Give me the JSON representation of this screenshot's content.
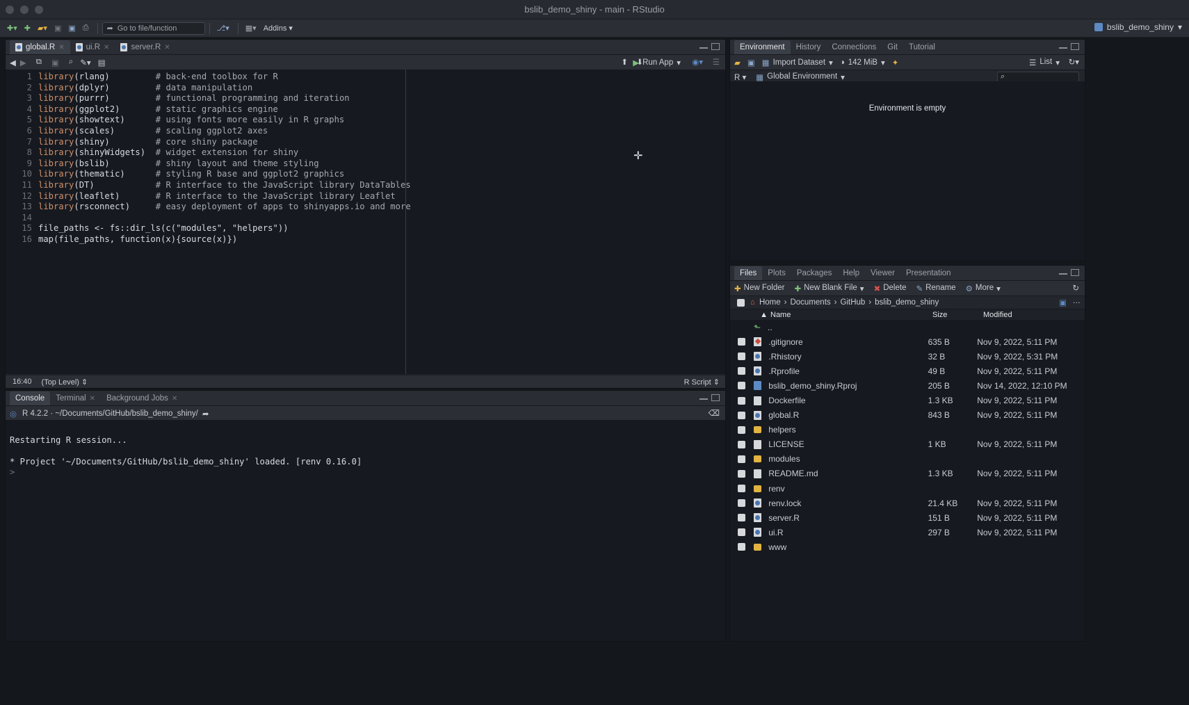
{
  "window": {
    "title": "bslib_demo_shiny - main - RStudio"
  },
  "toolbar": {
    "goto_placeholder": "Go to file/function",
    "addins_label": "Addins",
    "project_label": "bslib_demo_shiny"
  },
  "source": {
    "tabs": [
      {
        "label": "global.R",
        "active": true
      },
      {
        "label": "ui.R",
        "active": false
      },
      {
        "label": "server.R",
        "active": false
      }
    ],
    "run_app_label": "Run App",
    "lines": [
      {
        "n": "1",
        "pkg": "rlang",
        "comment": "# back-end toolbox for R"
      },
      {
        "n": "2",
        "pkg": "dplyr",
        "comment": "# data manipulation"
      },
      {
        "n": "3",
        "pkg": "purrr",
        "comment": "# functional programming and iteration"
      },
      {
        "n": "4",
        "pkg": "ggplot2",
        "comment": "# static graphics engine"
      },
      {
        "n": "5",
        "pkg": "showtext",
        "comment": "# using fonts more easily in R graphs"
      },
      {
        "n": "6",
        "pkg": "scales",
        "comment": "# scaling ggplot2 axes"
      },
      {
        "n": "7",
        "pkg": "shiny",
        "comment": "# core shiny package"
      },
      {
        "n": "8",
        "pkg": "shinyWidgets",
        "comment": "# widget extension for shiny"
      },
      {
        "n": "9",
        "pkg": "bslib",
        "comment": "# shiny layout and theme styling"
      },
      {
        "n": "10",
        "pkg": "thematic",
        "comment": "# styling R base and ggplot2 graphics"
      },
      {
        "n": "11",
        "pkg": "DT",
        "comment": "# R interface to the JavaScript library DataTables"
      },
      {
        "n": "12",
        "pkg": "leaflet",
        "comment": "# R interface to the JavaScript library Leaflet"
      },
      {
        "n": "13",
        "pkg": "rsconnect",
        "comment": "# easy deployment of apps to shinyapps.io and more"
      }
    ],
    "line14": "14",
    "line15_n": "15",
    "line15": "file_paths <- fs::dir_ls(c(\"modules\", \"helpers\"))",
    "line16_n": "16",
    "line16": "map(file_paths, function(x){source(x)})",
    "status": {
      "cursor": "16:40",
      "scope": "(Top Level)",
      "type": "R Script"
    }
  },
  "console": {
    "tabs": [
      "Console",
      "Terminal",
      "Background Jobs"
    ],
    "path": "R 4.2.2 · ~/Documents/GitHub/bslib_demo_shiny/",
    "lines": [
      "Restarting R session...",
      "",
      "* Project '~/Documents/GitHub/bslib_demo_shiny' loaded. [renv 0.16.0]",
      ">"
    ]
  },
  "environment": {
    "tabs": [
      "Environment",
      "History",
      "Connections",
      "Git",
      "Tutorial"
    ],
    "import_label": "Import Dataset",
    "memory": "142 MiB",
    "view_mode": "List",
    "lang": "R",
    "scope": "Global Environment",
    "empty_msg": "Environment is empty"
  },
  "files": {
    "tabs": [
      "Files",
      "Plots",
      "Packages",
      "Help",
      "Viewer",
      "Presentation"
    ],
    "actions": [
      "New Folder",
      "New Blank File",
      "Delete",
      "Rename",
      "More"
    ],
    "breadcrumb": [
      "Home",
      "Documents",
      "GitHub",
      "bslib_demo_shiny"
    ],
    "columns": {
      "name": "Name",
      "size": "Size",
      "modified": "Modified"
    },
    "up": "..",
    "rows": [
      {
        "name": ".gitignore",
        "size": "635 B",
        "modified": "Nov 9, 2022, 5:11 PM",
        "icon": "git"
      },
      {
        "name": ".Rhistory",
        "size": "32 B",
        "modified": "Nov 9, 2022, 5:31 PM",
        "icon": "r"
      },
      {
        "name": ".Rprofile",
        "size": "49 B",
        "modified": "Nov 9, 2022, 5:11 PM",
        "icon": "r"
      },
      {
        "name": "bslib_demo_shiny.Rproj",
        "size": "205 B",
        "modified": "Nov 14, 2022, 12:10 PM",
        "icon": "proj"
      },
      {
        "name": "Dockerfile",
        "size": "1.3 KB",
        "modified": "Nov 9, 2022, 5:11 PM",
        "icon": "doc"
      },
      {
        "name": "global.R",
        "size": "843 B",
        "modified": "Nov 9, 2022, 5:11 PM",
        "icon": "r"
      },
      {
        "name": "helpers",
        "size": "",
        "modified": "",
        "icon": "folder"
      },
      {
        "name": "LICENSE",
        "size": "1 KB",
        "modified": "Nov 9, 2022, 5:11 PM",
        "icon": "doc"
      },
      {
        "name": "modules",
        "size": "",
        "modified": "",
        "icon": "folder"
      },
      {
        "name": "README.md",
        "size": "1.3 KB",
        "modified": "Nov 9, 2022, 5:11 PM",
        "icon": "doc"
      },
      {
        "name": "renv",
        "size": "",
        "modified": "",
        "icon": "folder"
      },
      {
        "name": "renv.lock",
        "size": "21.4 KB",
        "modified": "Nov 9, 2022, 5:11 PM",
        "icon": "r"
      },
      {
        "name": "server.R",
        "size": "151 B",
        "modified": "Nov 9, 2022, 5:11 PM",
        "icon": "r"
      },
      {
        "name": "ui.R",
        "size": "297 B",
        "modified": "Nov 9, 2022, 5:11 PM",
        "icon": "r"
      },
      {
        "name": "www",
        "size": "",
        "modified": "",
        "icon": "folder"
      }
    ]
  },
  "colors": {
    "background": "#14171c",
    "pane": "#161a20",
    "accent": "#4a76b0",
    "folder": "#e3b341"
  }
}
